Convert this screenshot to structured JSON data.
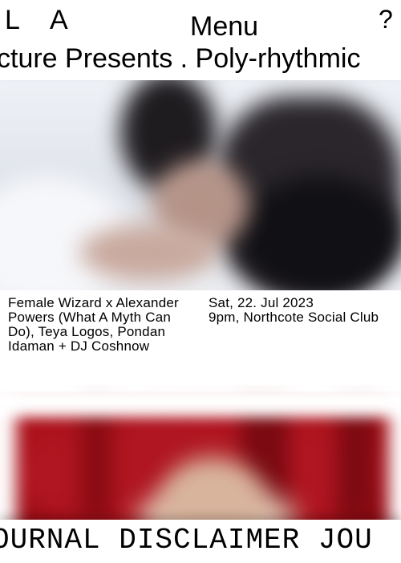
{
  "header": {
    "logo_letter_1": "L",
    "logo_letter_2": "A",
    "menu_label": "Menu",
    "help_label": "?"
  },
  "ticker": {
    "text": "cture Presents . Poly-rhythmic"
  },
  "events": [
    {
      "title": "Female Wizard x Alexander Powers (What A Myth Can Do), Teya Logos, Pondan Idaman + DJ Coshnow",
      "date": "Sat, 22. Jul 2023",
      "time_venue": "9pm, Northcote Social Club"
    }
  ],
  "footer": {
    "ticker_text": "OURNAL DISCLAIMER JOU"
  },
  "colors": {
    "background": "#ffffff",
    "text": "#000000"
  }
}
